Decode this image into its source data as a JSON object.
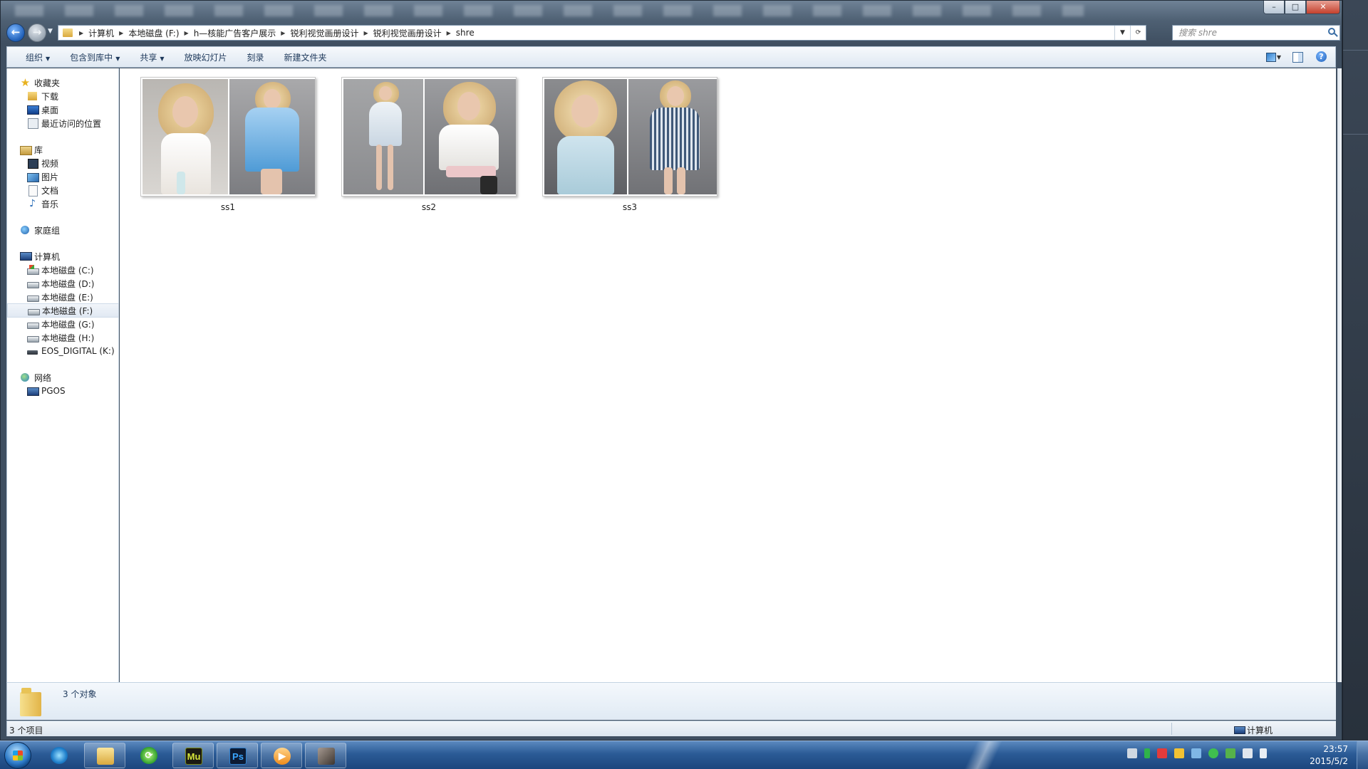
{
  "toolbar": {
    "organize": "组织",
    "include_library": "包含到库中",
    "share": "共享",
    "slideshow": "放映幻灯片",
    "burn": "刻录",
    "new_folder": "新建文件夹"
  },
  "breadcrumb": [
    "计算机",
    "本地磁盘 (F:)",
    "h—核能广告客户展示",
    "锐利视觉画册设计",
    "锐利视觉画册设计",
    "shre"
  ],
  "search": {
    "placeholder": "搜索 shre"
  },
  "sidebar": {
    "favorites": {
      "label": "收藏夹",
      "items": [
        {
          "label": "下载",
          "icon": "download-folder-icon"
        },
        {
          "label": "桌面",
          "icon": "desktop-icon"
        },
        {
          "label": "最近访问的位置",
          "icon": "recent-places-icon"
        }
      ]
    },
    "libraries": {
      "label": "库",
      "items": [
        {
          "label": "视频",
          "icon": "video-library-icon"
        },
        {
          "label": "图片",
          "icon": "pictures-library-icon"
        },
        {
          "label": "文档",
          "icon": "documents-library-icon"
        },
        {
          "label": "音乐",
          "icon": "music-library-icon"
        }
      ]
    },
    "homegroup": {
      "label": "家庭组"
    },
    "computer": {
      "label": "计算机",
      "items": [
        {
          "label": "本地磁盘 (C:)",
          "icon": "system-drive-icon"
        },
        {
          "label": "本地磁盘 (D:)",
          "icon": "drive-icon"
        },
        {
          "label": "本地磁盘 (E:)",
          "icon": "drive-icon"
        },
        {
          "label": "本地磁盘 (F:)",
          "icon": "drive-icon",
          "selected": true
        },
        {
          "label": "本地磁盘 (G:)",
          "icon": "drive-icon"
        },
        {
          "label": "本地磁盘 (H:)",
          "icon": "drive-icon"
        },
        {
          "label": "EOS_DIGITAL (K:)",
          "icon": "removable-drive-icon"
        }
      ]
    },
    "network": {
      "label": "网络",
      "items": [
        {
          "label": "PGOS",
          "icon": "network-computer-icon"
        }
      ]
    }
  },
  "files": [
    {
      "name": "ss1"
    },
    {
      "name": "ss2"
    },
    {
      "name": "ss3"
    }
  ],
  "details": {
    "summary": "3 个对象"
  },
  "status": {
    "left": "3 个项目",
    "right": "计算机"
  },
  "clock": {
    "time": "23:57",
    "date": "2015/5/2"
  },
  "colors": {
    "accent": "#1e395b",
    "selection": "#e1e9f3",
    "taskbar": "#2b5b96"
  }
}
